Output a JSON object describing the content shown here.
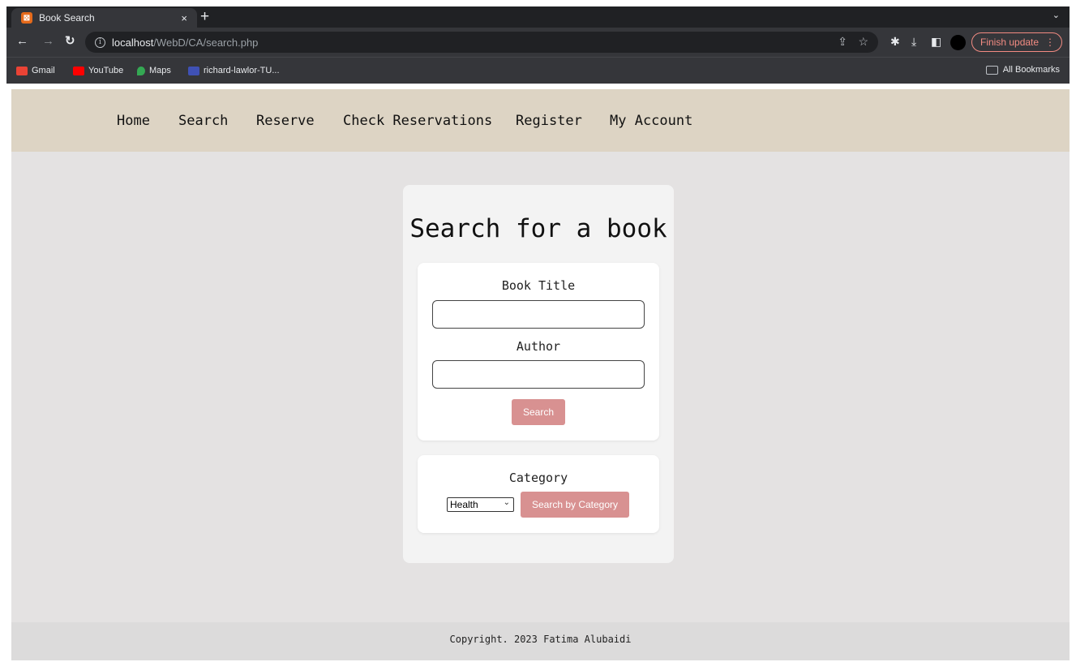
{
  "browser": {
    "tab_title": "Book Search",
    "tab_close": "×",
    "new_tab": "+",
    "tab_menu": "⌄",
    "url_host": "localhost",
    "url_path": "/WebD/CA/search.php",
    "update_label": "Finish update",
    "update_menu": "⋮",
    "bookmarks": [
      {
        "label": "Gmail",
        "color": "#ea4335"
      },
      {
        "label": "YouTube",
        "color": "#ff0000"
      },
      {
        "label": "Maps",
        "color": "#34a853"
      },
      {
        "label": "richard-lawlor-TU...",
        "color": "#3f51b5"
      }
    ],
    "all_bookmarks": "All Bookmarks"
  },
  "nav": {
    "items": [
      "Home",
      "Search",
      "Reserve",
      "Check Reservations",
      "Register",
      "My Account"
    ]
  },
  "search_card": {
    "title": "Search for a book",
    "book_title_label": "Book Title",
    "book_title_value": "",
    "author_label": "Author",
    "author_value": "",
    "search_button": "Search",
    "category_label": "Category",
    "category_selected": "Health",
    "category_button": "Search by Category"
  },
  "footer": {
    "text": "Copyright. 2023 Fatima Alubaidi"
  },
  "colors": {
    "navbar_bg": "#ddd4c4",
    "page_bg": "#e4e2e2",
    "button_accent": "#d89191"
  }
}
